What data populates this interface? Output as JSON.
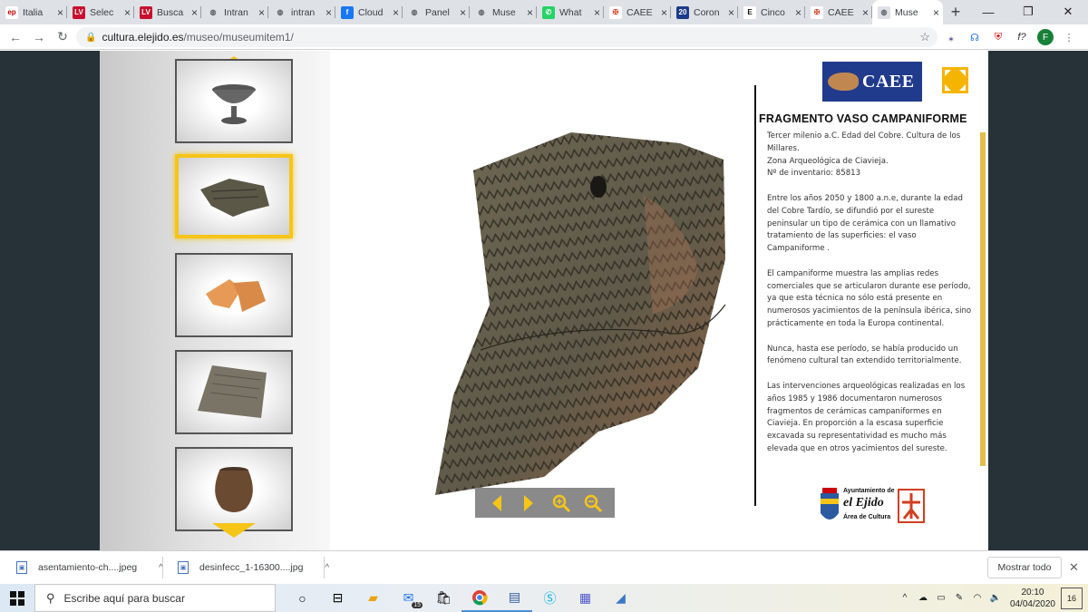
{
  "browser": {
    "tabs": [
      {
        "label": "Italia",
        "fav": "ep",
        "fav_bg": "#ffffff",
        "fav_color": "#c00000"
      },
      {
        "label": "Selec",
        "fav": "LV",
        "fav_bg": "#c8102e",
        "fav_color": "#ffffff"
      },
      {
        "label": "Busca",
        "fav": "LV",
        "fav_bg": "#c8102e",
        "fav_color": "#ffffff"
      },
      {
        "label": "Intran",
        "fav": "◍",
        "fav_bg": "#dee1e6",
        "fav_color": "#5f6368"
      },
      {
        "label": "intran",
        "fav": "◍",
        "fav_bg": "#dee1e6",
        "fav_color": "#5f6368"
      },
      {
        "label": "Cloud",
        "fav": "f",
        "fav_bg": "#1877f2",
        "fav_color": "#ffffff"
      },
      {
        "label": "Panel",
        "fav": "◍",
        "fav_bg": "#dee1e6",
        "fav_color": "#5f6368"
      },
      {
        "label": "Muse",
        "fav": "◍",
        "fav_bg": "#dee1e6",
        "fav_color": "#5f6368"
      },
      {
        "label": "What",
        "fav": "✆",
        "fav_bg": "#25d366",
        "fav_color": "#ffffff"
      },
      {
        "label": "CAEE",
        "fav": "✠",
        "fav_bg": "#ffffff",
        "fav_color": "#d04020"
      },
      {
        "label": "Coron",
        "fav": "20",
        "fav_bg": "#1b3b8a",
        "fav_color": "#ffffff"
      },
      {
        "label": "Cinco",
        "fav": "E",
        "fav_bg": "#ffffff",
        "fav_color": "#111111"
      },
      {
        "label": "CAEE",
        "fav": "✠",
        "fav_bg": "#ffffff",
        "fav_color": "#d04020"
      },
      {
        "label": "Muse",
        "fav": "◍",
        "fav_bg": "#dee1e6",
        "fav_color": "#5f6368",
        "active": true
      }
    ],
    "new_tab": "+",
    "close_glyph": "×",
    "window_controls": [
      "—",
      "❐",
      "✕"
    ],
    "address": {
      "host": "cultura.elejido.es",
      "path": "/museo/museumitem1/"
    },
    "profile_initial": "F",
    "extensions": [
      "⁎",
      "☊",
      "⛨",
      "f?"
    ]
  },
  "museum": {
    "thumbs": [
      {
        "name": "copa",
        "selected": false
      },
      {
        "name": "fragmento",
        "selected": true
      },
      {
        "name": "ceramica-naranja",
        "selected": false
      },
      {
        "name": "placa",
        "selected": false
      },
      {
        "name": "vasija",
        "selected": false
      }
    ],
    "logo_text": "CAEE",
    "title": "FRAGMENTO VASO CAMPANIFORME",
    "paragraphs": [
      "Tercer milenio a.C. Edad del Cobre. Cultura de los Millares.\nZona Arqueológica de Ciavieja.\nNº de inventario: 85813",
      "Entre los años 2050 y 1800 a.n.e, durante la edad del Cobre Tardío, se difundió por el sureste peninsular un tipo de cerámica con un llamativo tratamiento de las superficies: el  vaso Campaniforme .",
      "El campaniforme muestra las amplias redes comerciales que se articularon durante ese período, ya que esta técnica no sólo está presente en numerosos yacimientos de la península ibérica, sino prácticamente en toda la Europa continental.",
      "Nunca, hasta ese período, se había producido un fenómeno cultural tan extendido territorialmente.",
      "Las intervenciones arqueológicas realizadas en los años 1985 y 1986 documentaron numerosos fragmentos de cerámicas campaniformes en Ciavieja. En proporción a la escasa superficie excavada su representatividad es mucho más elevada que en otros yacimientos del sureste."
    ],
    "footer_logo": {
      "line1": "Ayuntamiento de",
      "line2": "el Ejido",
      "line3": "Área de Cultura"
    },
    "accent": "#f5c518"
  },
  "downloads": {
    "items": [
      "asentamiento-ch....jpeg",
      "desinfecc_1-16300....jpg"
    ],
    "show_all": "Mostrar todo"
  },
  "taskbar": {
    "search_placeholder": "Escribe aquí para buscar",
    "mail_badge": "15",
    "time": "20:10",
    "date": "04/04/2020",
    "notif_count": "16"
  }
}
